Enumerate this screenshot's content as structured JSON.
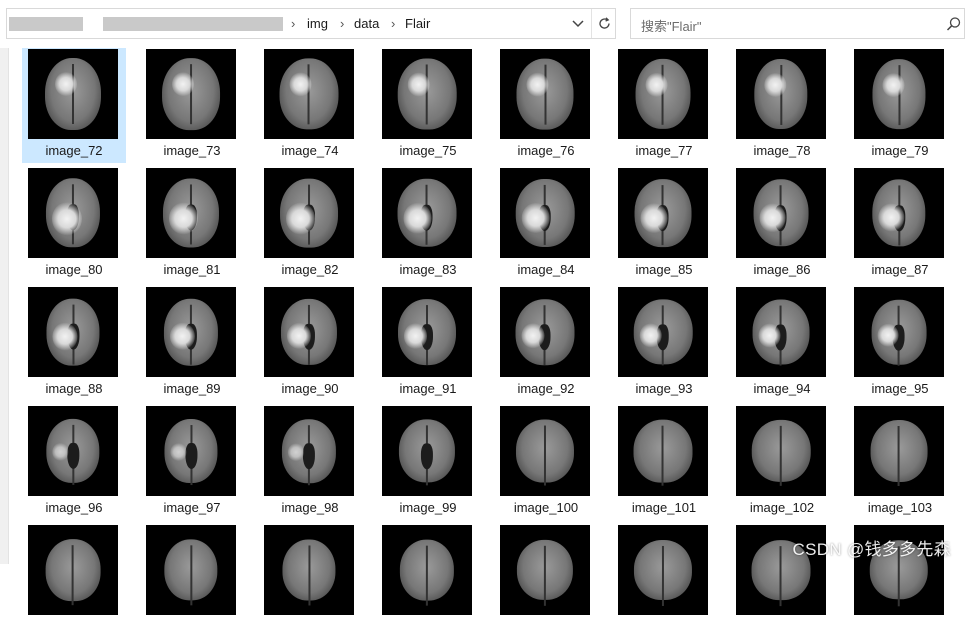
{
  "breadcrumb": {
    "items": [
      "img",
      "data",
      "Flair"
    ]
  },
  "search": {
    "placeholder": "搜索\"Flair\""
  },
  "icons": {
    "dropdown": "chevron-down-icon",
    "refresh": "refresh-icon",
    "search": "search-icon",
    "separator": "chevron-right-icon"
  },
  "files": [
    {
      "name": "image_72",
      "selected": true
    },
    {
      "name": "image_73"
    },
    {
      "name": "image_74"
    },
    {
      "name": "image_75"
    },
    {
      "name": "image_76"
    },
    {
      "name": "image_77"
    },
    {
      "name": "image_78"
    },
    {
      "name": "image_79"
    },
    {
      "name": "image_80"
    },
    {
      "name": "image_81"
    },
    {
      "name": "image_82"
    },
    {
      "name": "image_83"
    },
    {
      "name": "image_84"
    },
    {
      "name": "image_85"
    },
    {
      "name": "image_86"
    },
    {
      "name": "image_87"
    },
    {
      "name": "image_88"
    },
    {
      "name": "image_89"
    },
    {
      "name": "image_90"
    },
    {
      "name": "image_91"
    },
    {
      "name": "image_92"
    },
    {
      "name": "image_93"
    },
    {
      "name": "image_94"
    },
    {
      "name": "image_95"
    },
    {
      "name": "image_96"
    },
    {
      "name": "image_97"
    },
    {
      "name": "image_98"
    },
    {
      "name": "image_99"
    },
    {
      "name": "image_100"
    },
    {
      "name": "image_101"
    },
    {
      "name": "image_102"
    },
    {
      "name": "image_103"
    },
    {
      "name": ""
    },
    {
      "name": ""
    },
    {
      "name": ""
    },
    {
      "name": ""
    },
    {
      "name": ""
    },
    {
      "name": ""
    },
    {
      "name": ""
    },
    {
      "name": ""
    }
  ],
  "watermark": "CSDN @钱多多先森"
}
